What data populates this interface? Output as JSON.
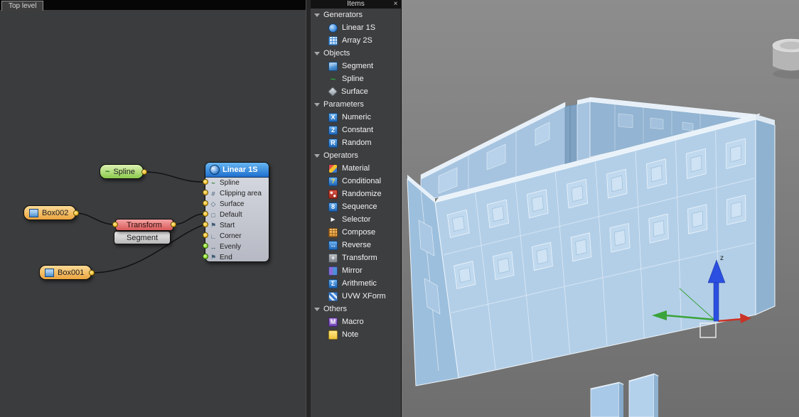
{
  "editor": {
    "tab_label": "Top level",
    "nodes": {
      "spline": {
        "label": "Spline",
        "glyph": "~"
      },
      "box002": {
        "label": "Box002"
      },
      "transform": {
        "label": "Transform"
      },
      "segment": {
        "label": "Segment"
      },
      "box001": {
        "label": "Box001"
      },
      "linear": {
        "title": "Linear 1S",
        "inputs": [
          {
            "label": "Spline",
            "glyph": "~"
          },
          {
            "label": "Clipping area",
            "glyph": "#"
          },
          {
            "label": "Surface",
            "glyph": "◇"
          },
          {
            "label": "Default",
            "glyph": "□"
          },
          {
            "label": "Start",
            "glyph": "⚑"
          },
          {
            "label": "Corner",
            "glyph": "∟"
          },
          {
            "label": "Evenly",
            "glyph": "↔"
          },
          {
            "label": "End",
            "glyph": "⚑"
          }
        ]
      }
    }
  },
  "items_panel": {
    "title": "Items",
    "close_glyph": "×",
    "groups": [
      {
        "label": "Generators",
        "items": [
          {
            "label": "Linear 1S",
            "glyph": ""
          },
          {
            "label": "Array 2S",
            "glyph": ""
          }
        ]
      },
      {
        "label": "Objects",
        "items": [
          {
            "label": "Segment",
            "glyph": ""
          },
          {
            "label": "Spline",
            "glyph": "~"
          },
          {
            "label": "Surface",
            "glyph": ""
          }
        ]
      },
      {
        "label": "Parameters",
        "items": [
          {
            "label": "Numeric",
            "glyph": "X"
          },
          {
            "label": "Constant",
            "glyph": "2"
          },
          {
            "label": "Random",
            "glyph": "R"
          }
        ]
      },
      {
        "label": "Operators",
        "items": [
          {
            "label": "Material",
            "glyph": ""
          },
          {
            "label": "Conditional",
            "glyph": "?"
          },
          {
            "label": "Randomize",
            "glyph": ""
          },
          {
            "label": "Sequence",
            "glyph": "8"
          },
          {
            "label": "Selector",
            "glyph": "►"
          },
          {
            "label": "Compose",
            "glyph": ""
          },
          {
            "label": "Reverse",
            "glyph": "↔"
          },
          {
            "label": "Transform",
            "glyph": "+"
          },
          {
            "label": "Mirror",
            "glyph": ""
          },
          {
            "label": "Arithmetic",
            "glyph": "Σ"
          },
          {
            "label": "UVW XForm",
            "glyph": ""
          }
        ]
      },
      {
        "label": "Others",
        "items": [
          {
            "label": "Macro",
            "glyph": "M"
          },
          {
            "label": "Note",
            "glyph": ""
          }
        ]
      }
    ]
  },
  "viewport": {
    "axis_label": "z"
  },
  "colors": {
    "accent_blue": "#2f7fd6",
    "socket_yellow": "#f2b722",
    "socket_green": "#7ed321",
    "node_orange": "#eca43e",
    "node_green": "#8bc94d",
    "node_red": "#d95a5a",
    "wall_blue": "#b3cfe8",
    "viewport_gray": "#7d7d7d"
  }
}
